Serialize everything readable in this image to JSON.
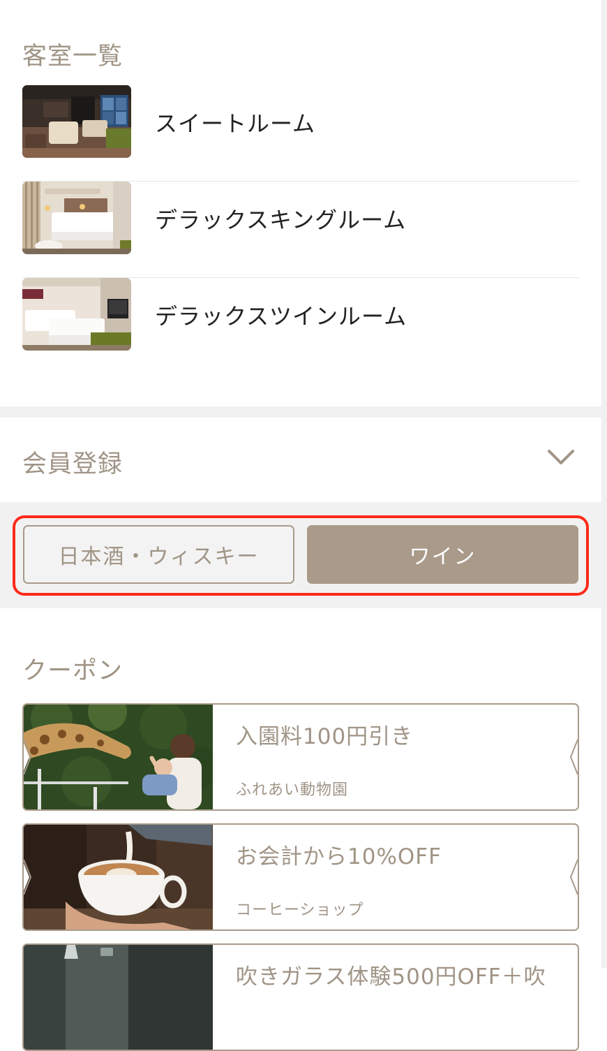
{
  "rooms_section": {
    "title": "客室一覧",
    "rooms": [
      {
        "name": "スイートルーム"
      },
      {
        "name": "デラックスキングルーム"
      },
      {
        "name": "デラックスツインルーム"
      }
    ]
  },
  "membership": {
    "title": "会員登録",
    "icon": "chevron-down-icon"
  },
  "tabs": {
    "items": [
      {
        "label": "日本酒・ウィスキー",
        "selected": false
      },
      {
        "label": "ワイン",
        "selected": true
      }
    ],
    "highlight_color": "#ff2a1a"
  },
  "coupon_section": {
    "title": "クーポン",
    "coupons": [
      {
        "title": "入園料100円引き",
        "subtitle": "ふれあい動物園"
      },
      {
        "title": "お会計から10%OFF",
        "subtitle": "コーヒーショップ"
      },
      {
        "title": "吹きガラス体験500円OFF＋吹",
        "subtitle": ""
      }
    ]
  },
  "colors": {
    "accent": "#a99a8a",
    "accent_text": "#a09486",
    "text": "#222222",
    "divider": "#e6e6e6",
    "band": "#f1f1f1"
  }
}
